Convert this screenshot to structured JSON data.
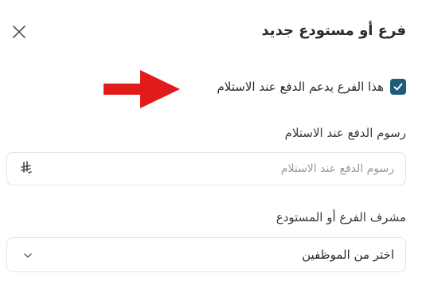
{
  "modal": {
    "title": "فرع أو مستودع جديد",
    "close_icon": "close-icon"
  },
  "cod_checkbox": {
    "label": "هذا الفرع يدعم الدفع عند الاستلام",
    "checked": true,
    "color": "#1c5c78"
  },
  "annotation": {
    "arrow_color": "#e11b1b"
  },
  "cod_fee": {
    "label": "رسوم الدفع عند الاستلام",
    "placeholder": "رسوم الدفع عند الاستلام",
    "currency_symbol": "⃁",
    "currency_icon": "saudi-riyal-icon"
  },
  "supervisor": {
    "label": "مشرف الفرع أو المستودع",
    "selected": "اختر من الموظفين",
    "chevron_icon": "chevron-down-icon"
  }
}
